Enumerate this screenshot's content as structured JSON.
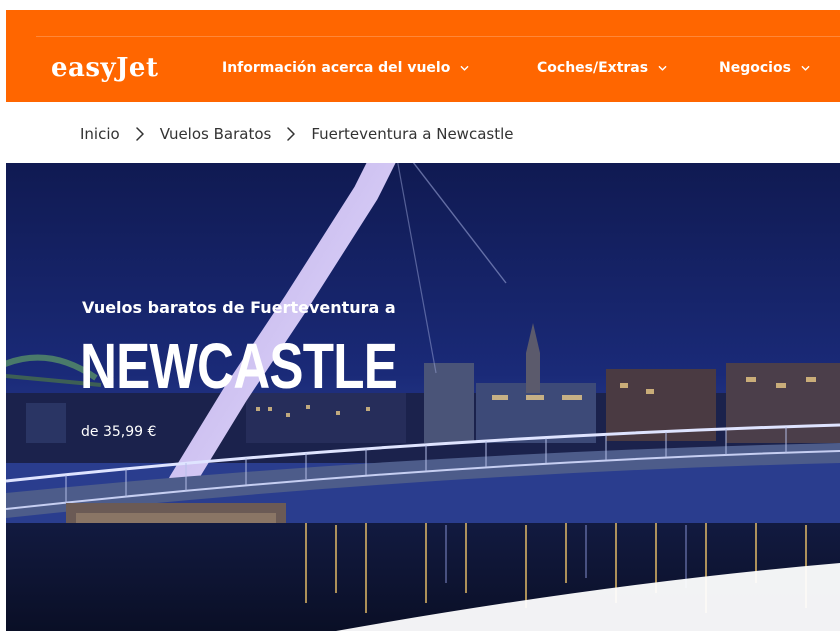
{
  "header": {
    "logo_text": "easyJet",
    "brand_color": "#ff6600",
    "nav": [
      {
        "label": "Información acerca del vuelo",
        "icon": "chevron-down-icon"
      },
      {
        "label": "Coches/Extras",
        "icon": "chevron-down-icon"
      },
      {
        "label": "Negocios",
        "icon": "chevron-down-icon"
      }
    ]
  },
  "breadcrumb": {
    "items": [
      "Inicio",
      "Vuelos Baratos",
      "Fuerteventura a Newcastle"
    ],
    "separator_icon": "chevron-right-icon"
  },
  "hero": {
    "subtitle": "Vuelos baratos de Fuerteventura a",
    "title": "NEWCASTLE",
    "price": "de 35,99 €",
    "background_color": "#13205e"
  }
}
